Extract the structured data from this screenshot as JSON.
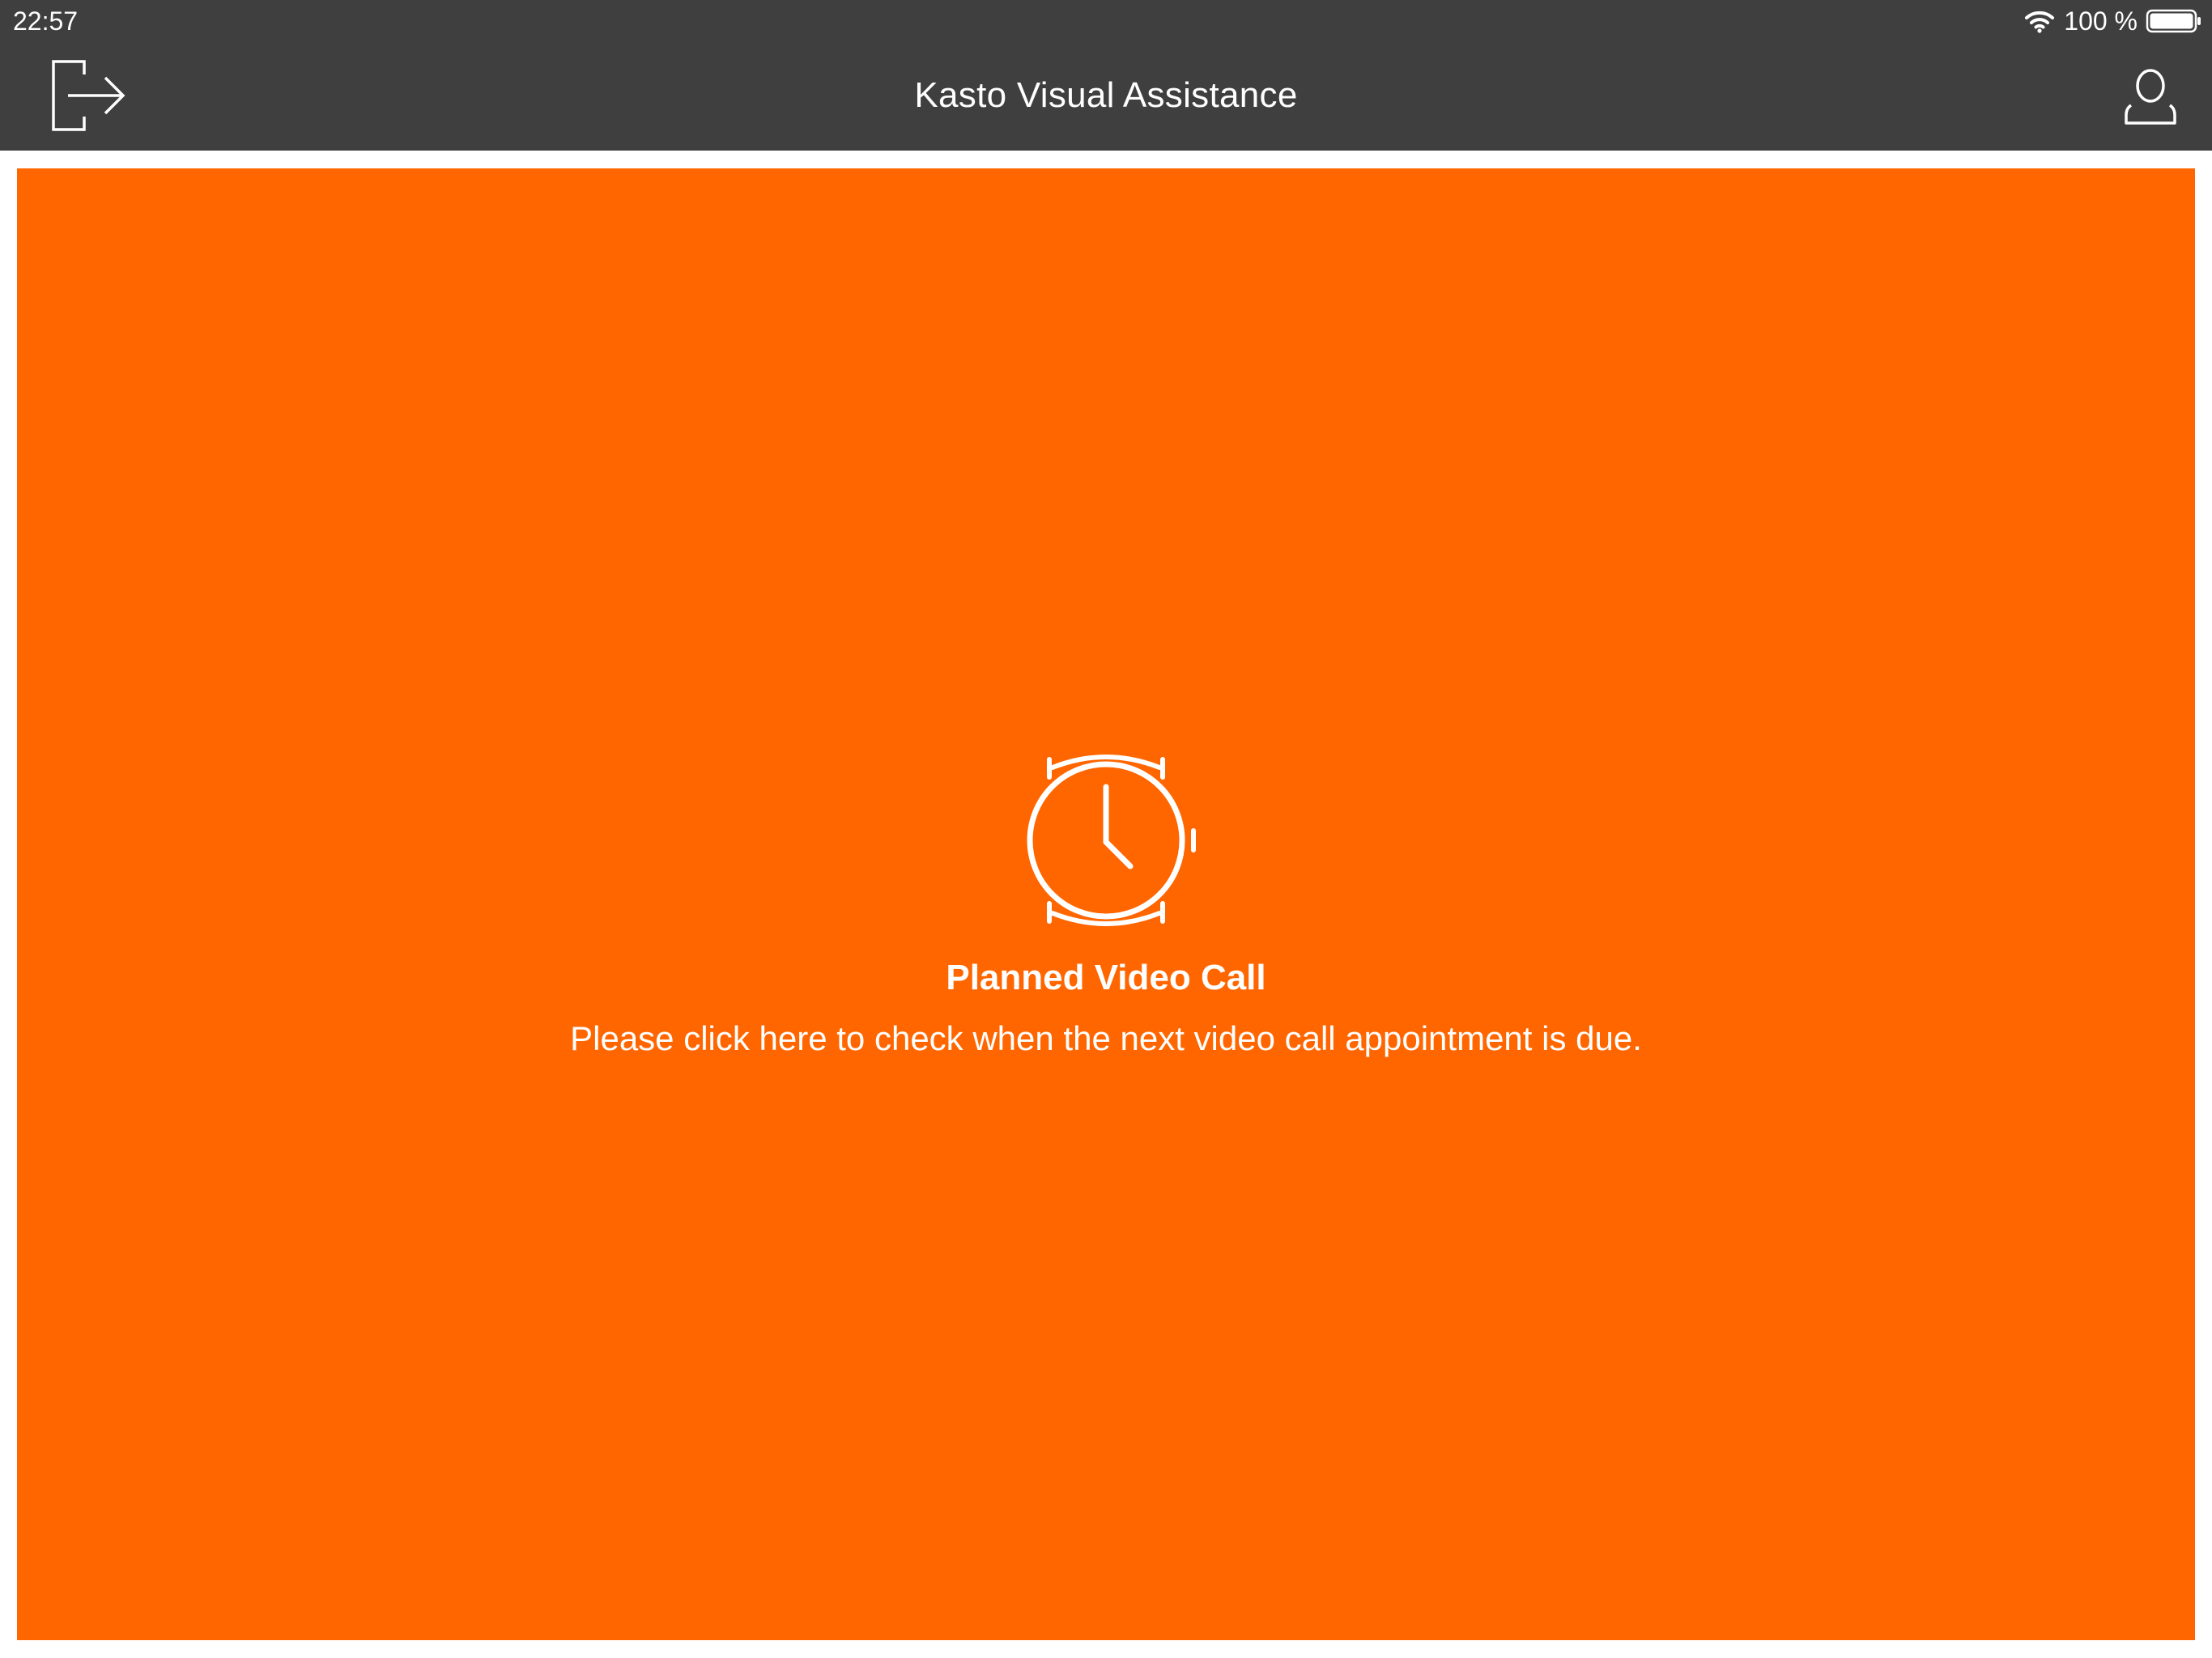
{
  "status_bar": {
    "time": "22:57",
    "battery_text": "100 %",
    "battery_level": 1.0,
    "wifi_icon": "wifi-icon",
    "battery_icon": "battery-icon"
  },
  "header": {
    "title": "Kasto Visual Assistance",
    "left_icon": "logout-icon",
    "right_icon": "user-profile-icon"
  },
  "main": {
    "icon": "watch-icon",
    "title": "Planned Video Call",
    "subtitle": "Please click here to check when the next video call appointment is due."
  },
  "colors": {
    "bar": "#3f3f3f",
    "accent": "#ff6600",
    "text_on_accent": "#ffffff"
  }
}
